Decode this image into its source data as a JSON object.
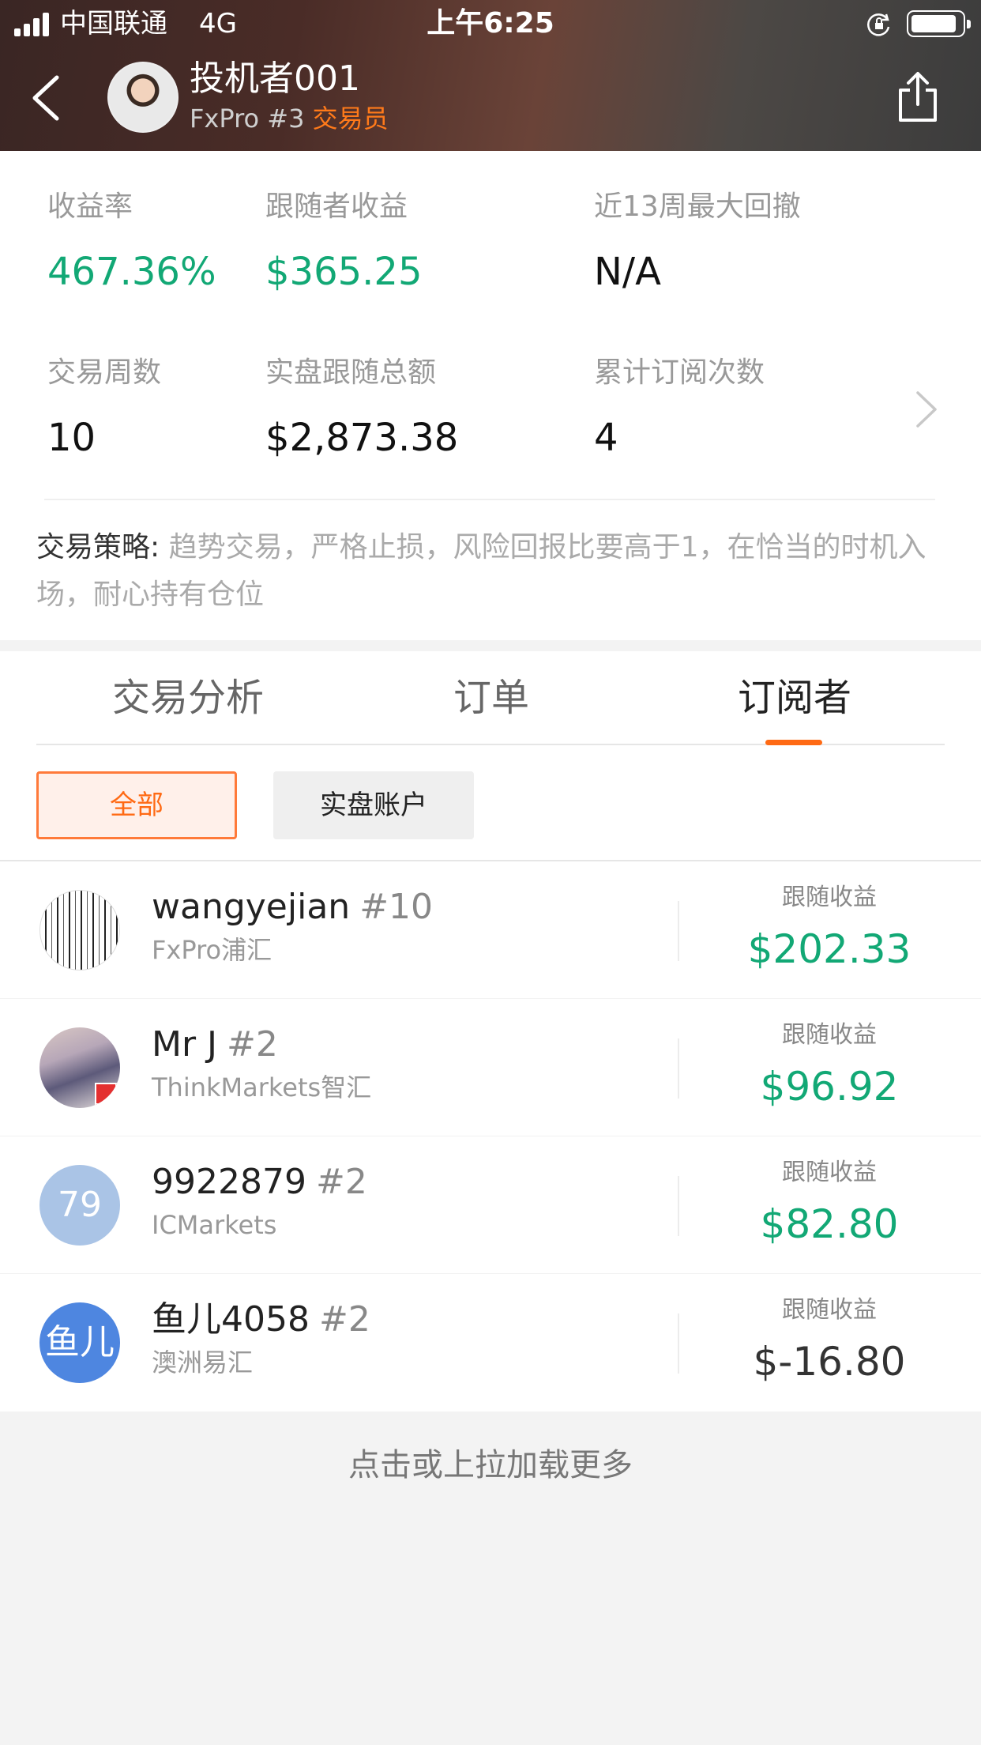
{
  "status_bar": {
    "carrier": "中国联通",
    "network": "4G",
    "time": "上午6:25"
  },
  "header": {
    "trader_name": "投机者001",
    "broker_rank": "FxPro #3",
    "role": "交易员"
  },
  "stats": [
    {
      "label": "收益率",
      "value": "467.36%"
    },
    {
      "label": "跟随者收益",
      "value": "$365.25"
    },
    {
      "label": "近13周最大回撤",
      "value": "N/A"
    },
    {
      "label": "交易周数",
      "value": "10"
    },
    {
      "label": "实盘跟随总额",
      "value": "$2,873.38"
    },
    {
      "label": "累计订阅次数",
      "value": "4"
    }
  ],
  "strategy": {
    "label": "交易策略:",
    "text": " 趋势交易，严格止损，风险回报比要高于1，在恰当的时机入场，耐心持有仓位"
  },
  "tabs": [
    "交易分析",
    "订单",
    "订阅者"
  ],
  "active_tab": "订阅者",
  "filters": {
    "all": "全部",
    "real": "实盘账户"
  },
  "subscribers": [
    {
      "name": "wangyejian",
      "rank": "#10",
      "broker": "FxPro浦汇",
      "pl_label": "跟随收益",
      "pl_value": "$202.33",
      "avatar_text": ""
    },
    {
      "name": "Mr J",
      "rank": "#2",
      "broker": "ThinkMarkets智汇",
      "pl_label": "跟随收益",
      "pl_value": "$96.92",
      "avatar_text": ""
    },
    {
      "name": "9922879",
      "rank": "#2",
      "broker": "ICMarkets",
      "pl_label": "跟随收益",
      "pl_value": "$82.80",
      "avatar_text": "79"
    },
    {
      "name": "鱼儿4058",
      "rank": "#2",
      "broker": "澳洲易汇",
      "pl_label": "跟随收益",
      "pl_value": "$-16.80",
      "avatar_text": "鱼儿"
    }
  ],
  "load_more": "点击或上拉加载更多",
  "colors": {
    "accent": "#ff6a14",
    "profit": "#12a875",
    "loss": "#333333"
  }
}
